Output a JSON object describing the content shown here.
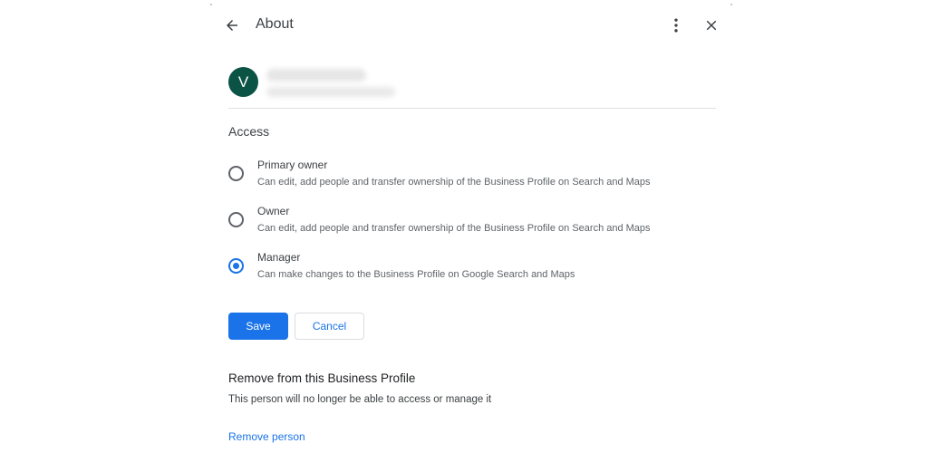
{
  "header": {
    "title": "About",
    "back_icon": "arrow-left-icon",
    "more_icon": "more-vert-icon",
    "close_icon": "close-icon"
  },
  "user": {
    "avatar_initial": "V",
    "avatar_color": "#0b5345"
  },
  "access": {
    "label": "Access",
    "options": [
      {
        "title": "Primary owner",
        "description": "Can edit, add people and transfer ownership of the Business Profile on Search and Maps",
        "selected": false
      },
      {
        "title": "Owner",
        "description": "Can edit, add people and transfer ownership of the Business Profile on Search and Maps",
        "selected": false
      },
      {
        "title": "Manager",
        "description": "Can make changes to the Business Profile on Google Search and Maps",
        "selected": true
      }
    ]
  },
  "actions": {
    "save_label": "Save",
    "cancel_label": "Cancel"
  },
  "remove": {
    "title": "Remove from this Business Profile",
    "description": "This person will no longer be able to access or manage it",
    "link_label": "Remove person"
  },
  "colors": {
    "accent": "#1a73e8",
    "text_primary": "#202124",
    "text_secondary": "#5f6368"
  }
}
